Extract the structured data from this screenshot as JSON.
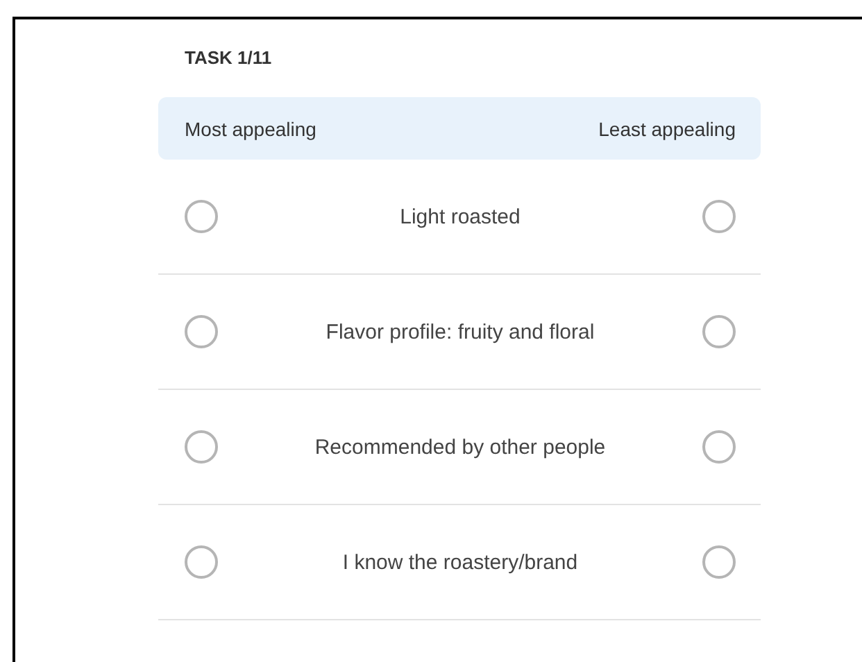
{
  "task_label": "TASK 1/11",
  "header": {
    "left": "Most appealing",
    "right": "Least appealing"
  },
  "items": [
    {
      "label": "Light roasted",
      "most_selected": false,
      "least_selected": false
    },
    {
      "label": "Flavor profile: fruity and floral",
      "most_selected": false,
      "least_selected": false
    },
    {
      "label": "Recommended by other people",
      "most_selected": false,
      "least_selected": false
    },
    {
      "label": "I know the roastery/brand",
      "most_selected": false,
      "least_selected": false
    }
  ]
}
